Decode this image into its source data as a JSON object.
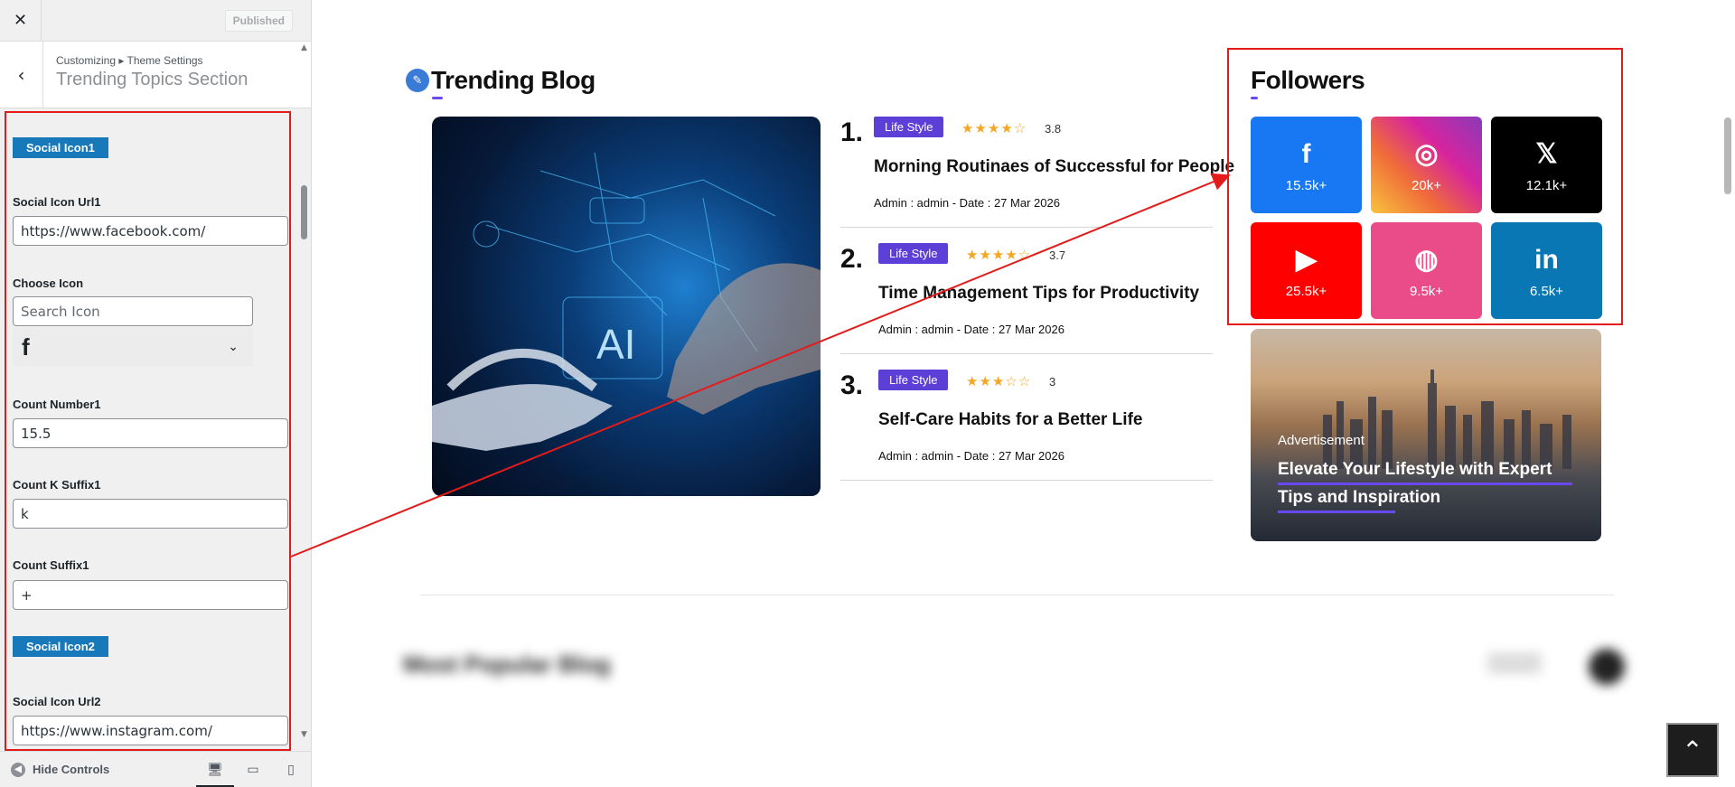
{
  "sidebar": {
    "close_icon": "close-icon",
    "published_label": "Published",
    "breadcrumb": "Customizing ▸ Theme Settings",
    "section_title": "Trending Topics Section",
    "fields": {
      "social_icon1_tag": "Social Icon1",
      "url1_label": "Social Icon Url1",
      "url1_value": "https://www.facebook.com/",
      "choose_icon_label": "Choose Icon",
      "search_icon_placeholder": "Search Icon",
      "selected_icon": "facebook-icon",
      "count_number_label": "Count Number1",
      "count_number_value": "15.5",
      "count_k_label": "Count K Suffix1",
      "count_k_value": "k",
      "count_suffix_label": "Count Suffix1",
      "count_suffix_value": "+",
      "social_icon2_tag": "Social Icon2",
      "url2_label": "Social Icon Url2",
      "url2_value": "https://www.instagram.com/"
    },
    "footer": {
      "hide_controls": "Hide Controls",
      "devices": [
        "desktop-icon",
        "tablet-icon",
        "mobile-icon"
      ]
    }
  },
  "main": {
    "trending_title": "Trending Blog",
    "posts": [
      {
        "number": "1.",
        "tag": "Life Style",
        "rating": "3.8",
        "title": "Morning Routinaes of Successful for People",
        "meta": "Admin : admin   -   Date : 27 Mar 2026"
      },
      {
        "number": "2.",
        "tag": "Life Style",
        "rating": "3.7",
        "title": "Time Management Tips for Productivity",
        "meta": "Admin : admin   -   Date : 27 Mar 2026"
      },
      {
        "number": "3.",
        "tag": "Life Style",
        "rating": "3",
        "title": "Self-Care Habits for a Better Life",
        "meta": "Admin : admin   -   Date : 27 Mar 2026"
      }
    ],
    "followers_title": "Followers",
    "socials": [
      {
        "icon": "facebook-icon",
        "glyph": "f",
        "count": "15.5k+",
        "color": "#1877f2"
      },
      {
        "icon": "instagram-icon",
        "glyph": "◎",
        "count": "20k+",
        "color": "#d6249f"
      },
      {
        "icon": "x-icon",
        "glyph": "𝕏",
        "count": "12.1k+",
        "color": "#000000"
      },
      {
        "icon": "youtube-icon",
        "glyph": "▶",
        "count": "25.5k+",
        "color": "#ff0000"
      },
      {
        "icon": "dribbble-icon",
        "glyph": "◍",
        "count": "9.5k+",
        "color": "#ea4c89"
      },
      {
        "icon": "linkedin-icon",
        "glyph": "in",
        "count": "6.5k+",
        "color": "#0a77b5"
      }
    ],
    "ad": {
      "label": "Advertisement",
      "headline": "Elevate Your Lifestyle with Expert Tips and Inspiration"
    },
    "blurred_heading": "Most Popular Blog"
  }
}
